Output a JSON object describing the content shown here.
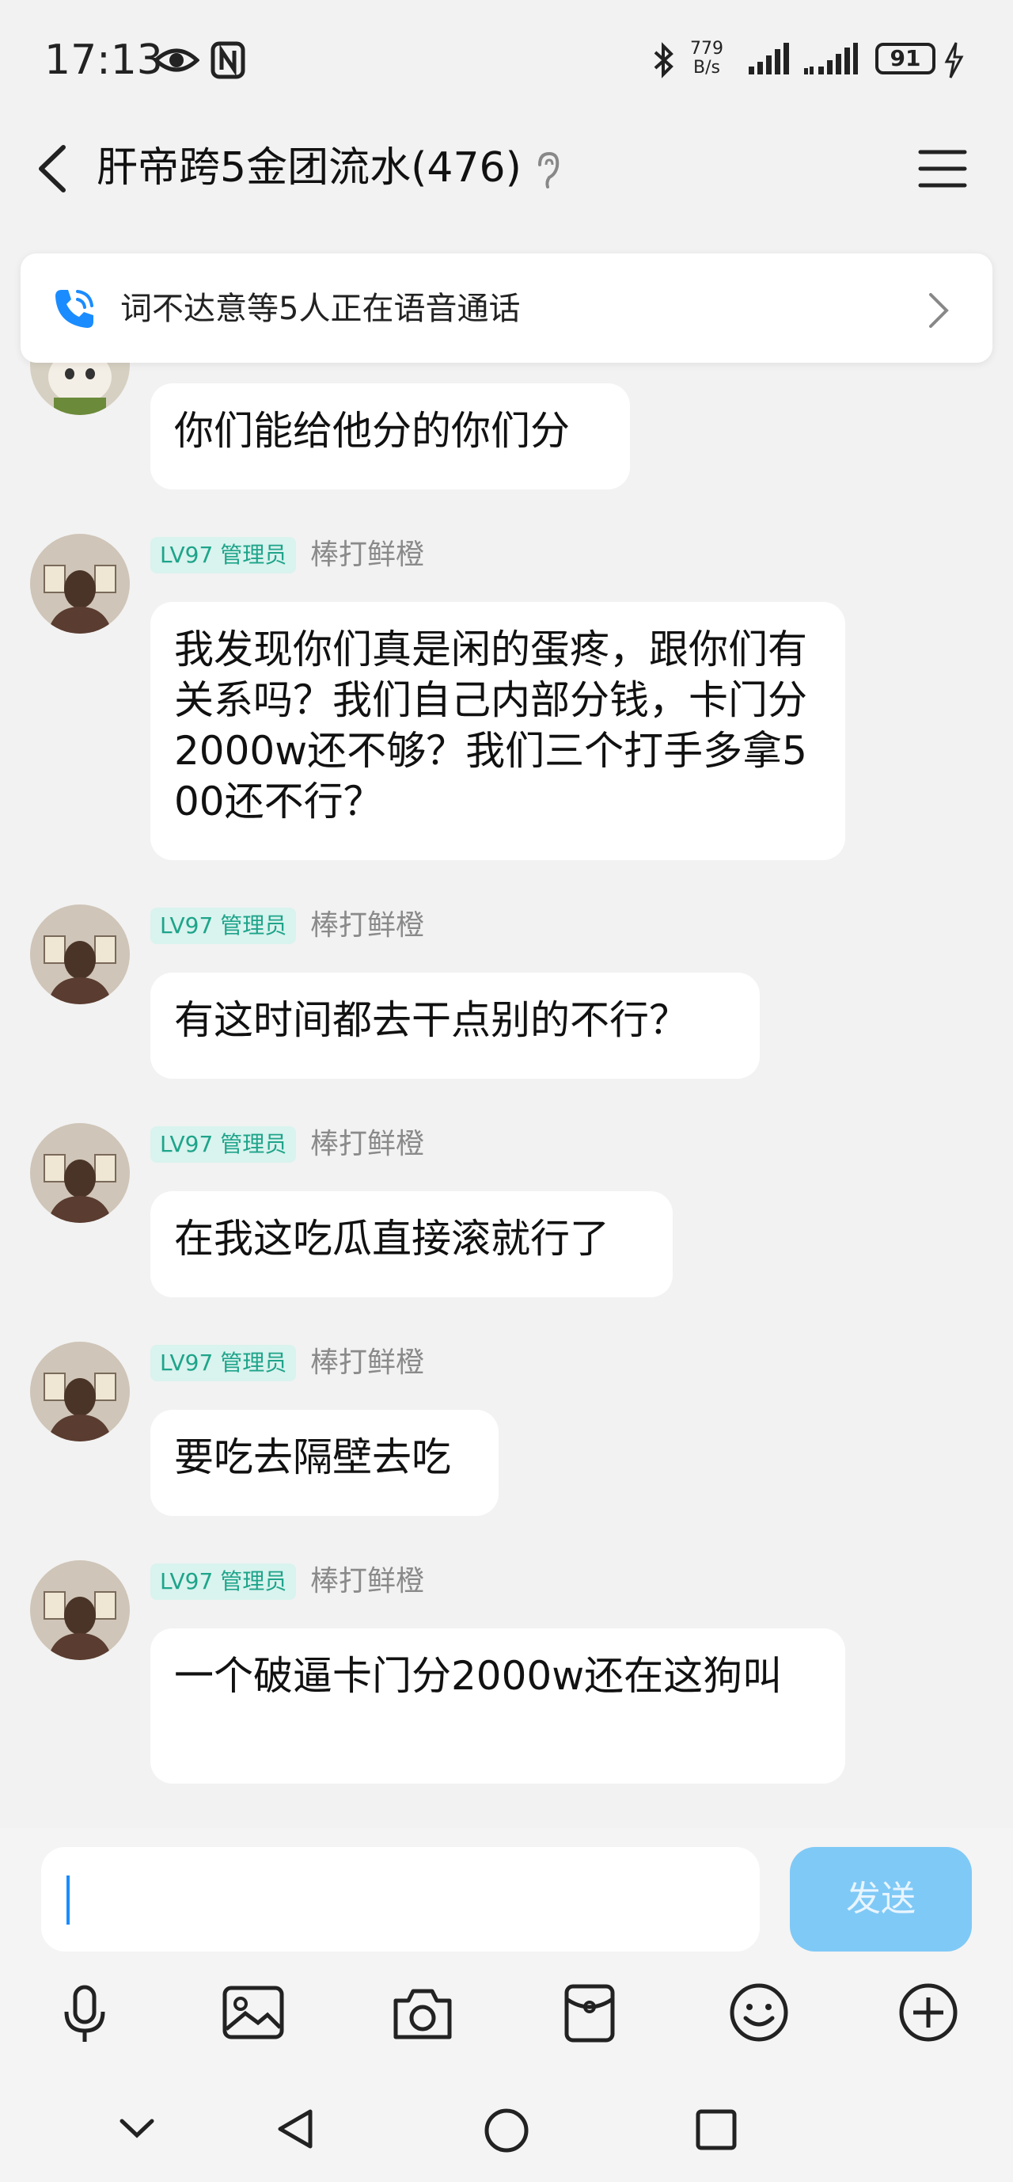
{
  "status_bar": {
    "time": "17:13",
    "net_speed_value": "779",
    "net_speed_unit": "B/s",
    "battery": "91"
  },
  "header": {
    "title": "肝帝跨5金团流水(476)"
  },
  "voice_banner": {
    "text": "词不达意等5人正在语音通话"
  },
  "messages": [
    {
      "text": "你们能给他分的你们分"
    },
    {
      "badge": "LV97 管理员",
      "sender": "棒打鲜橙",
      "text": "我发现你们真是闲的蛋疼，跟你们有关系吗？我们自己内部分钱，卡门分2000w还不够？我们三个打手多拿500还不行？"
    },
    {
      "badge": "LV97 管理员",
      "sender": "棒打鲜橙",
      "text": "有这时间都去干点别的不行？"
    },
    {
      "badge": "LV97 管理员",
      "sender": "棒打鲜橙",
      "text": "在我这吃瓜直接滚就行了"
    },
    {
      "badge": "LV97 管理员",
      "sender": "棒打鲜橙",
      "text": "要吃去隔壁去吃"
    },
    {
      "badge": "LV97 管理员",
      "sender": "棒打鲜橙",
      "text": "一个破逼卡门分2000w还在这狗叫"
    }
  ],
  "input": {
    "value": "",
    "send_label": "发送"
  },
  "toolbar_icons": [
    "microphone-icon",
    "image-icon",
    "camera-icon",
    "red-packet-icon",
    "emoji-icon",
    "plus-icon"
  ],
  "nav_icons": [
    "collapse-icon",
    "back-triangle-icon",
    "home-circle-icon",
    "recents-square-icon"
  ],
  "colors": {
    "badge_bg": "#d9f3ee",
    "badge_text": "#1ea48a",
    "send_button": "#7fc9f6",
    "call_icon": "#1a8cff"
  }
}
